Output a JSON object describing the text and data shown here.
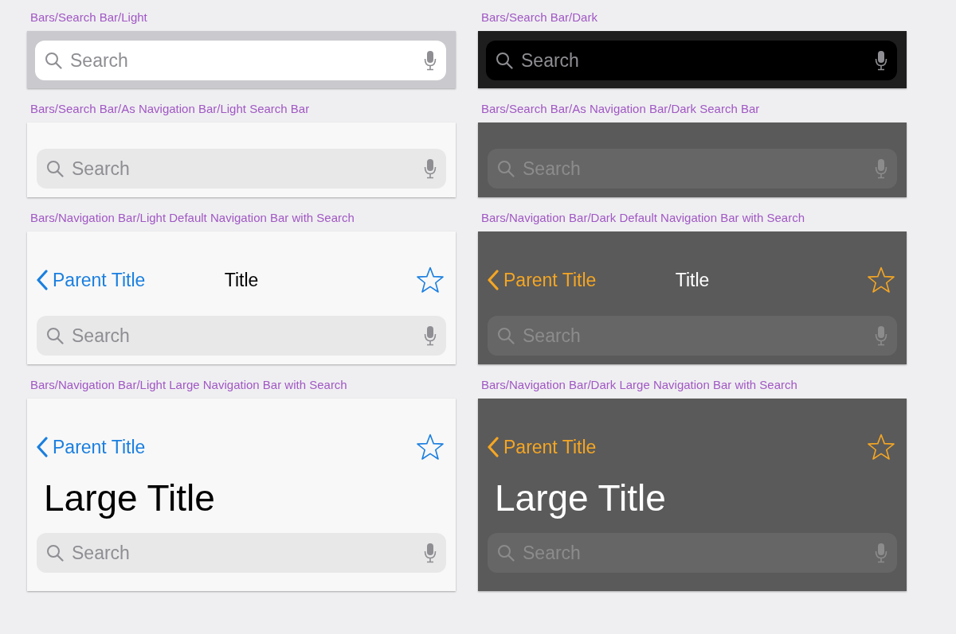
{
  "sections": [
    {
      "label": "Bars/Search Bar/Light",
      "dark": false,
      "kind": "search_bar",
      "search": {
        "placeholder": "Search"
      }
    },
    {
      "label": "Bars/Search Bar/Dark",
      "dark": true,
      "kind": "search_bar",
      "search": {
        "placeholder": "Search"
      }
    },
    {
      "label": "Bars/Search Bar/As Navigation Bar/Light Search Bar",
      "dark": false,
      "kind": "nav_search",
      "search": {
        "placeholder": "Search"
      }
    },
    {
      "label": "Bars/Search Bar/As Navigation Bar/Dark Search Bar",
      "dark": true,
      "kind": "nav_search",
      "search": {
        "placeholder": "Search"
      }
    },
    {
      "label": "Bars/Navigation Bar/Light Default Navigation Bar with Search",
      "dark": false,
      "kind": "default_nav",
      "nav": {
        "back": "Parent Title",
        "title": "Title"
      },
      "search": {
        "placeholder": "Search"
      }
    },
    {
      "label": "Bars/Navigation Bar/Dark Default Navigation Bar with Search",
      "dark": true,
      "kind": "default_nav",
      "nav": {
        "back": "Parent Title",
        "title": "Title"
      },
      "search": {
        "placeholder": "Search"
      }
    },
    {
      "label": "Bars/Navigation Bar/Light Large Navigation Bar with Search",
      "dark": false,
      "kind": "large_nav",
      "nav": {
        "back": "Parent Title",
        "large_title": "Large Title"
      },
      "search": {
        "placeholder": "Search"
      }
    },
    {
      "label": "Bars/Navigation Bar/Dark Large Navigation Bar with Search",
      "dark": true,
      "kind": "large_nav",
      "nav": {
        "back": "Parent Title",
        "large_title": "Large Title"
      },
      "search": {
        "placeholder": "Search"
      }
    }
  ]
}
